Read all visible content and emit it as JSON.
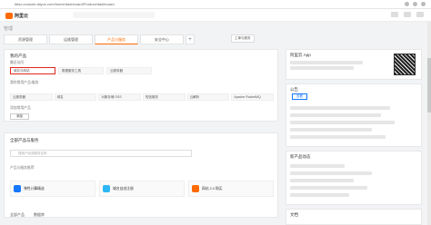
{
  "browser": {
    "url": "fdiso.console.aliyun.com/home/dashboard/Product/dashboard"
  },
  "brand": {
    "logo_text": "阿里云"
  },
  "breadcrumb": "管理",
  "tabs": [
    {
      "label": "资源管理"
    },
    {
      "label": "运维管理"
    },
    {
      "label": "产品与服务"
    },
    {
      "label": "安全中心"
    }
  ],
  "tab_actions": {
    "add": "+",
    "right_btn1": "工单与服务",
    "right_btn2": "工单与服务"
  },
  "main": {
    "recent_title": "我的产品",
    "recent_sub": "最近访问",
    "recent_items": [
      "域名与网站",
      "数据服务工具",
      "云服务器"
    ],
    "services_title": "我的常用产品/服务",
    "services_items": [
      "云服务器",
      "域名",
      "对象存储 OSS",
      "短信服务",
      "云解析",
      "Apache RocketMQ"
    ],
    "add_label": "添加常用产品",
    "add_button": "添加"
  },
  "card2": {
    "title": "全部产品与服务",
    "search_placeholder": "搜索产品或服务名称",
    "sub_title": "产品与服务推荐",
    "promos": [
      {
        "text": "弹性计算精选",
        "color": "#1677ff"
      },
      {
        "text": "域名自由注册",
        "color": "#2db7f5"
      },
      {
        "text": "网站 2.0 购买",
        "color": "#ff6a00"
      }
    ],
    "bottom_tabs": [
      "全部产品",
      "数据库"
    ]
  },
  "right": {
    "app_title": "阿里云 App",
    "notice_title": "公告",
    "notice_btn": "查看",
    "news_title": "新产品动态",
    "docs_title": "文档"
  }
}
